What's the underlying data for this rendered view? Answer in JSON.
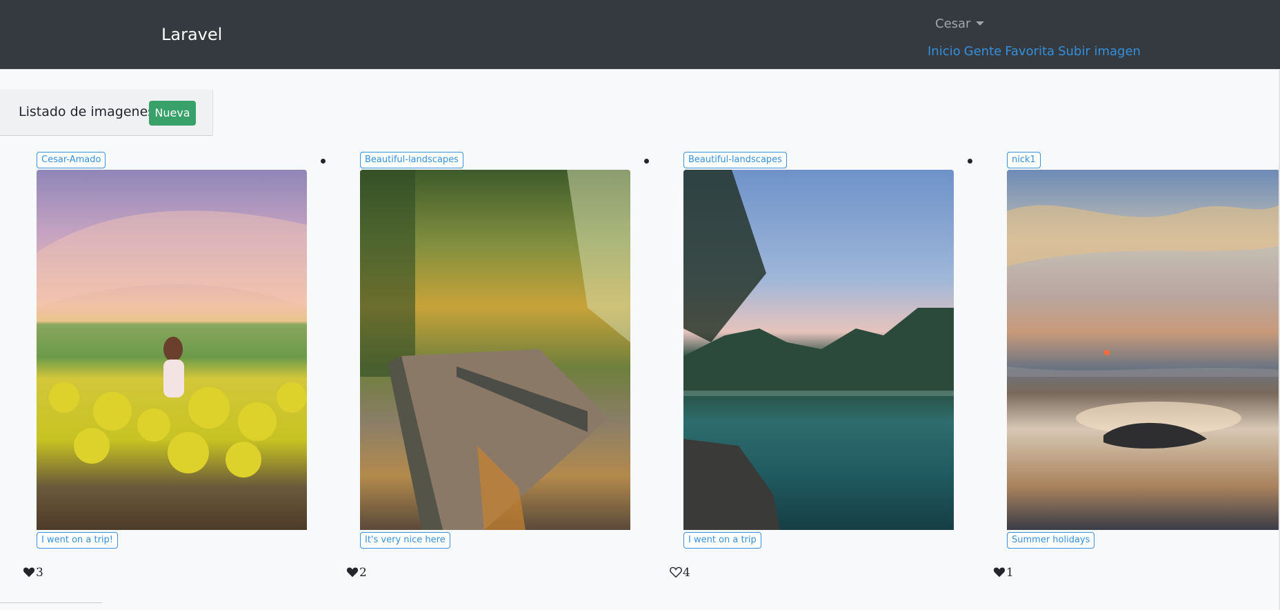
{
  "navbar": {
    "brand": "Laravel",
    "user_menu": "Cesar",
    "links": [
      "Inicio",
      "Gente",
      "Favorita",
      "Subir imagen"
    ]
  },
  "header": {
    "title": "Listado de imagenes",
    "new_button": "Nueva"
  },
  "images": [
    {
      "author": "Cesar-Amado",
      "description": "I went on a trip!",
      "likes": "3",
      "liked": true
    },
    {
      "author": "Beautiful-landscapes",
      "description": "It's very nice here",
      "likes": "2",
      "liked": true
    },
    {
      "author": "Beautiful-landscapes",
      "description": "I went on a trip",
      "likes": "4",
      "liked": false
    },
    {
      "author": "nick1",
      "description": "Summer holidays",
      "likes": "1",
      "liked": true
    }
  ],
  "colors": {
    "navbar_bg": "#343a40",
    "link": "#3490dc",
    "success": "#38a169"
  }
}
